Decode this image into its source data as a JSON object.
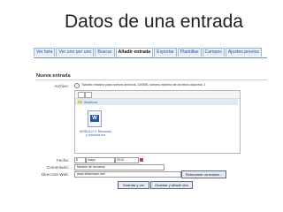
{
  "slide_title": "Datos de una entrada",
  "tabs": [
    "Ver lista",
    "Ver uno por uno",
    "Buscar",
    "Añadir entrada",
    "Exportar",
    "Plantillas",
    "Campos",
    "Ajustes previos"
  ],
  "active_tab": "Añadir entrada",
  "section_title": "Nueva entrada",
  "fields": {
    "archivo_label": "Archivo:",
    "archivo_hint": "Tamaño máximo para nuevos archivos: 100MB, número máximo de archivos adjuntos: 1",
    "folder_label": "Archivos",
    "file_name": "MÓDULO 3. Recursos y módulos.sxr",
    "file_badge": "W",
    "fecha_label": "Fecha:",
    "fecha_day": "8",
    "fecha_month": "mayo",
    "fecha_year": "2014",
    "comentario_label": "Comentario:",
    "comentario_value": "Módulo de recursos",
    "direccion_label": "Dirección Web:",
    "direccion_value": "www.slideshare.net/",
    "link_button": "Seleccione un enlace..."
  },
  "buttons": {
    "save_view": "Guardar y ver",
    "save_add": "Guardar y añadir otro"
  }
}
